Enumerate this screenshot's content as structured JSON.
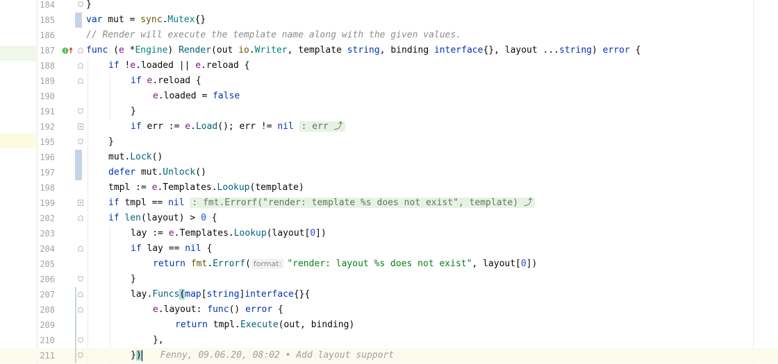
{
  "editor": {
    "blame_text": "Fenny, 09.06.20, 08:02 • Add layout support",
    "param_hint": "format:",
    "lines": [
      {
        "n": "184",
        "text": "}"
      },
      {
        "n": "185"
      },
      {
        "n": "186"
      },
      {
        "n": "187"
      },
      {
        "n": "188"
      },
      {
        "n": "189"
      },
      {
        "n": "190"
      },
      {
        "n": "191",
        "text": "}"
      },
      {
        "n": "192"
      },
      {
        "n": "195",
        "text": "}"
      },
      {
        "n": "196"
      },
      {
        "n": "197"
      },
      {
        "n": "198"
      },
      {
        "n": "199"
      },
      {
        "n": "202"
      },
      {
        "n": "203"
      },
      {
        "n": "204"
      },
      {
        "n": "205"
      },
      {
        "n": "206",
        "text": "}"
      },
      {
        "n": "207"
      },
      {
        "n": "208"
      },
      {
        "n": "209"
      },
      {
        "n": "210",
        "text": "},"
      },
      {
        "n": "211"
      }
    ]
  },
  "code": {
    "l185": {
      "var": "var",
      "mut": " mut = ",
      "sync": "sync",
      "dot": ".",
      "mutex": "Mutex",
      "br": "{}"
    },
    "l186": "// Render will execute the template name along with the given values.",
    "l187": {
      "func": "func",
      "p1": " (",
      "e": "e",
      "star": " *",
      "engine": "Engine",
      "p2": ") ",
      "render": "Render",
      "p3": "(out ",
      "io": "io",
      "dot": ".",
      "writer": "Writer",
      "p4": ", template ",
      "string": "string",
      "p5": ", binding ",
      "iface": "interface",
      "p6": "{}, layout ...",
      "string2": "string",
      "p7": ") ",
      "error": "error",
      "p8": " {"
    },
    "l188": {
      "if": "if",
      "p1": " !",
      "e": "e",
      "p2": ".loaded || ",
      "e2": "e",
      "p3": ".reload {"
    },
    "l189": {
      "if": "if",
      "p1": " ",
      "e": "e",
      "p2": ".reload {"
    },
    "l190": {
      "e": "e",
      "p1": ".loaded = ",
      "false": "false"
    },
    "l192": {
      "if": "if",
      "p1": " err := ",
      "e": "e",
      "p2": ".",
      "load": "Load",
      "p3": "(); err != ",
      "nil": "nil",
      "chip": ": err ⤴"
    },
    "l196": {
      "p1": "mut.",
      "lock": "Lock",
      "p2": "()"
    },
    "l197": {
      "defer": "defer",
      "p1": " mut.",
      "unlock": "Unlock",
      "p2": "()"
    },
    "l198": {
      "p1": "tmpl := ",
      "e": "e",
      "p2": ".Templates.",
      "lookup": "Lookup",
      "p3": "(template)"
    },
    "l199": {
      "if": "if",
      "p1": " tmpl == ",
      "nil": "nil",
      "chip": ": fmt.Errorf(\"render: template %s does not exist\", template) ⤴"
    },
    "l202": {
      "if": "if",
      "p1": " ",
      "len": "len",
      "p2": "(layout) > ",
      "zero": "0",
      "p3": " {"
    },
    "l203": {
      "p1": "lay := ",
      "e": "e",
      "p2": ".Templates.",
      "lookup": "Lookup",
      "p3": "(layout[",
      "zero": "0",
      "p4": "])"
    },
    "l204": {
      "if": "if",
      "p1": " lay == ",
      "nil": "nil",
      "p2": " {"
    },
    "l205": {
      "return": "return",
      "p1": " ",
      "fmt": "fmt",
      "p2": ".",
      "errorf": "Errorf",
      "p3": "(",
      "str": "\"render: layout %s does not exist\"",
      "p4": ", layout[",
      "zero": "0",
      "p5": "])"
    },
    "l207": {
      "p1": "lay.",
      "funcs": "Funcs",
      "p2": "(",
      "map": "map",
      "p3": "[",
      "string": "string",
      "p4": "]",
      "iface": "interface",
      "p5": "{}{"
    },
    "l208": {
      "e": "e",
      "p1": ".layout: ",
      "func": "func",
      "p2": "() ",
      "error": "error",
      "p3": " {"
    },
    "l209": {
      "return": "return",
      "p1": " tmpl.",
      "execute": "Execute",
      "p2": "(out, binding)"
    },
    "l211": {
      "br": "}",
      "paren": ")"
    }
  },
  "colors": {
    "keyword": "#0033b3",
    "function": "#00627a",
    "string": "#067d17",
    "comment": "#8c8c8c",
    "number": "#1750eb",
    "caret_row": "#fcfaed",
    "vcs_modified": "#c5d3e8",
    "vcs_added": "#c2dbc2"
  },
  "gutter_icons": [
    "implementation-marker-icon",
    "override-arrow-icon"
  ]
}
